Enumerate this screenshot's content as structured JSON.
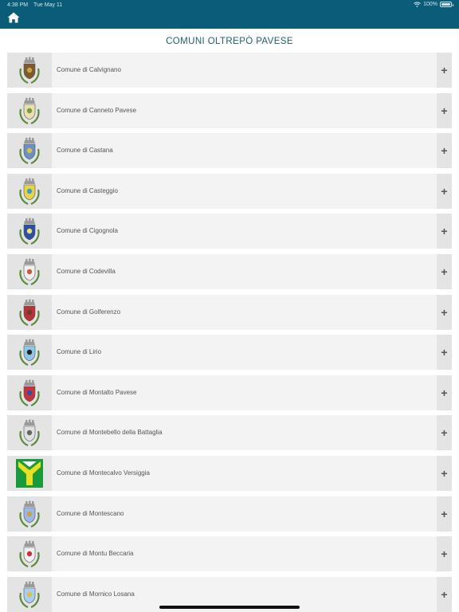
{
  "status": {
    "time": "4:38 PM",
    "date": "Tue May 11",
    "battery": "100%"
  },
  "header": {
    "home_icon": "home-icon",
    "bar_color": "#0b5c78"
  },
  "page": {
    "title": "COMUNI OLTREPÒ PAVESE"
  },
  "comuni": [
    {
      "name": "Comune di Calvignano",
      "shield": "#7d5a2e",
      "accent": "#caa24a"
    },
    {
      "name": "Comune di Canneto Pavese",
      "shield": "#e8e0b0",
      "accent": "#7a9a3a"
    },
    {
      "name": "Comune di Castana",
      "shield": "#6c8fc8",
      "accent": "#d8c24a"
    },
    {
      "name": "Comune di Casteggio",
      "shield": "#e8d44a",
      "accent": "#3aa0c8"
    },
    {
      "name": "Comune di Cigognola",
      "shield": "#2c4fa8",
      "accent": "#f0e070"
    },
    {
      "name": "Comune di Codevilla",
      "shield": "#f0f0f0",
      "accent": "#c85a3a"
    },
    {
      "name": "Comune di Golferenzo",
      "shield": "#b8323a",
      "accent": "#6a3a2a"
    },
    {
      "name": "Comune di Lirio",
      "shield": "#8ec8e8",
      "accent": "#222222"
    },
    {
      "name": "Comune di Montalto Pavese",
      "shield": "#c8323a",
      "accent": "#2c4fa8"
    },
    {
      "name": "Comune di Montebello della Battaglia",
      "shield": "#e0e0e0",
      "accent": "#666666"
    },
    {
      "name": "Comune di Montecalvo Versiggia",
      "shield": "#e8e020",
      "accent": "#1a9a3a"
    },
    {
      "name": "Comune di Montescano",
      "shield": "#9ab8e8",
      "accent": "#c8a04a"
    },
    {
      "name": "Comune di Montu Beccaria",
      "shield": "#f0f0f0",
      "accent": "#c8323a"
    },
    {
      "name": "Comune di Mornico Losana",
      "shield": "#a8d0f0",
      "accent": "#d8c24a"
    }
  ],
  "row_action": "+"
}
